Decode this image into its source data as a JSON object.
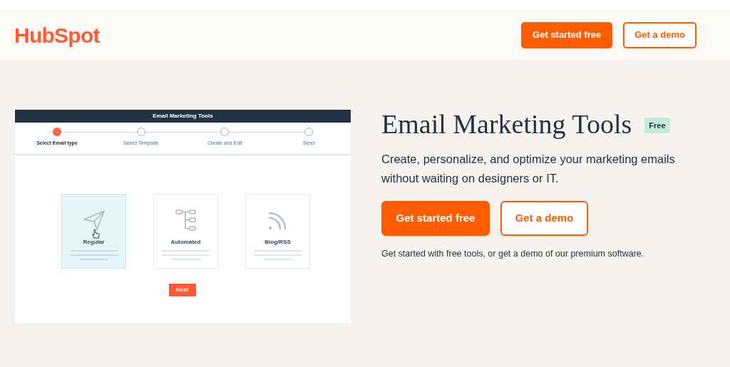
{
  "header": {
    "logo": "HubSpot",
    "buttons": [
      {
        "label": "Get started free",
        "kind": "primary"
      },
      {
        "label": "Get a demo",
        "kind": "secondary"
      }
    ]
  },
  "preview": {
    "title": "Email Marketing Tools",
    "steps": [
      {
        "label": "Select Email type",
        "selected": true
      },
      {
        "label": "Select Template",
        "selected": false
      },
      {
        "label": "Create and Edit",
        "selected": false
      },
      {
        "label": "Send",
        "selected": false
      }
    ],
    "cards": [
      {
        "label": "Regular",
        "kind": "send",
        "selected": true
      },
      {
        "label": "Automated",
        "kind": "workflow",
        "selected": false
      },
      {
        "label": "Blog/RSS",
        "kind": "rss",
        "selected": false
      }
    ],
    "next_button": "Next"
  },
  "hero": {
    "title": "Email Marketing Tools",
    "badge": "Free",
    "description": "Create, personalize, and optimize your marketing emails without waiting on designers or IT.",
    "buttons": [
      {
        "label": "Get started free",
        "kind": "primary"
      },
      {
        "label": "Get a demo",
        "kind": "secondary"
      }
    ],
    "note": "Get started with free tools, or get a demo of our premium software."
  }
}
